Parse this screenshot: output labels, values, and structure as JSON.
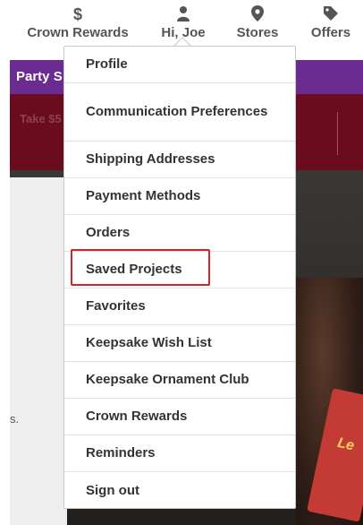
{
  "nav": {
    "rewards": {
      "label": "Crown Rewards",
      "icon": "dollar-icon",
      "glyph": "$"
    },
    "account": {
      "label": "Hi, Joe",
      "icon": "user-icon"
    },
    "stores": {
      "label": "Stores",
      "icon": "map-pin-icon"
    },
    "offers": {
      "label": "Offers",
      "icon": "tag-icon"
    }
  },
  "promo": {
    "text": "Party S"
  },
  "banner": {
    "text": "Take $5"
  },
  "hero": {
    "fragment": "s.",
    "card_text": "Le"
  },
  "account_menu": {
    "items": [
      {
        "label": "Profile"
      },
      {
        "label": "Communication Preferences"
      },
      {
        "label": "Shipping Addresses"
      },
      {
        "label": "Payment Methods"
      },
      {
        "label": "Orders"
      },
      {
        "label": "Saved Projects"
      },
      {
        "label": "Favorites"
      },
      {
        "label": "Keepsake Wish List"
      },
      {
        "label": "Keepsake Ornament Club"
      },
      {
        "label": "Crown Rewards"
      },
      {
        "label": "Reminders"
      },
      {
        "label": "Sign out"
      }
    ]
  },
  "colors": {
    "promo_purple": "#6a2c91",
    "banner_maroon": "#6a0b1e",
    "highlight_red": "#d5222a"
  }
}
